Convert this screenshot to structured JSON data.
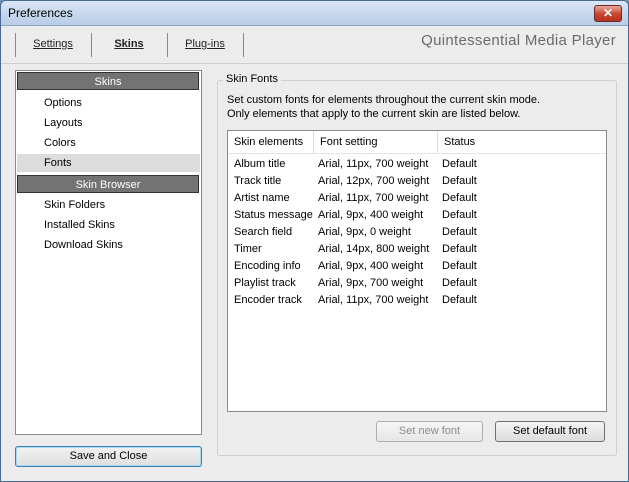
{
  "window": {
    "title": "Preferences",
    "close_icon": "close-icon"
  },
  "tabs": [
    {
      "label": "Settings",
      "active": false
    },
    {
      "label": "Skins",
      "active": true
    },
    {
      "label": "Plug-ins",
      "active": false
    }
  ],
  "app_name": "Quintessential Media Player",
  "sidebar": {
    "section_skins": "Skins",
    "items_top": [
      "Options",
      "Layouts",
      "Colors",
      "Fonts"
    ],
    "selected": "Fonts",
    "section_browser": "Skin Browser",
    "items_bottom": [
      "Skin Folders",
      "Installed Skins",
      "Download Skins"
    ]
  },
  "save_button": "Save and Close",
  "panel": {
    "group_label": "Skin Fonts",
    "description_line1": "Set custom fonts for elements throughout the current skin mode.",
    "description_line2": "Only elements that apply to the current skin are listed below.",
    "columns": [
      "Skin elements",
      "Font setting",
      "Status"
    ],
    "rows": [
      [
        "Album title",
        "Arial, 11px, 700 weight",
        "Default"
      ],
      [
        "Track title",
        "Arial, 12px, 700 weight",
        "Default"
      ],
      [
        "Artist name",
        "Arial, 11px, 700 weight",
        "Default"
      ],
      [
        "Status message",
        "Arial, 9px, 400 weight",
        "Default"
      ],
      [
        "Search field",
        "Arial, 9px, 0 weight",
        "Default"
      ],
      [
        "Timer",
        "Arial, 14px, 800 weight",
        "Default"
      ],
      [
        "Encoding info",
        "Arial, 9px, 400 weight",
        "Default"
      ],
      [
        "Playlist track",
        "Arial, 9px, 700 weight",
        "Default"
      ],
      [
        "Encoder track",
        "Arial, 11px, 700 weight",
        "Default"
      ]
    ],
    "btn_set_new": "Set new font",
    "btn_set_default": "Set default font"
  }
}
